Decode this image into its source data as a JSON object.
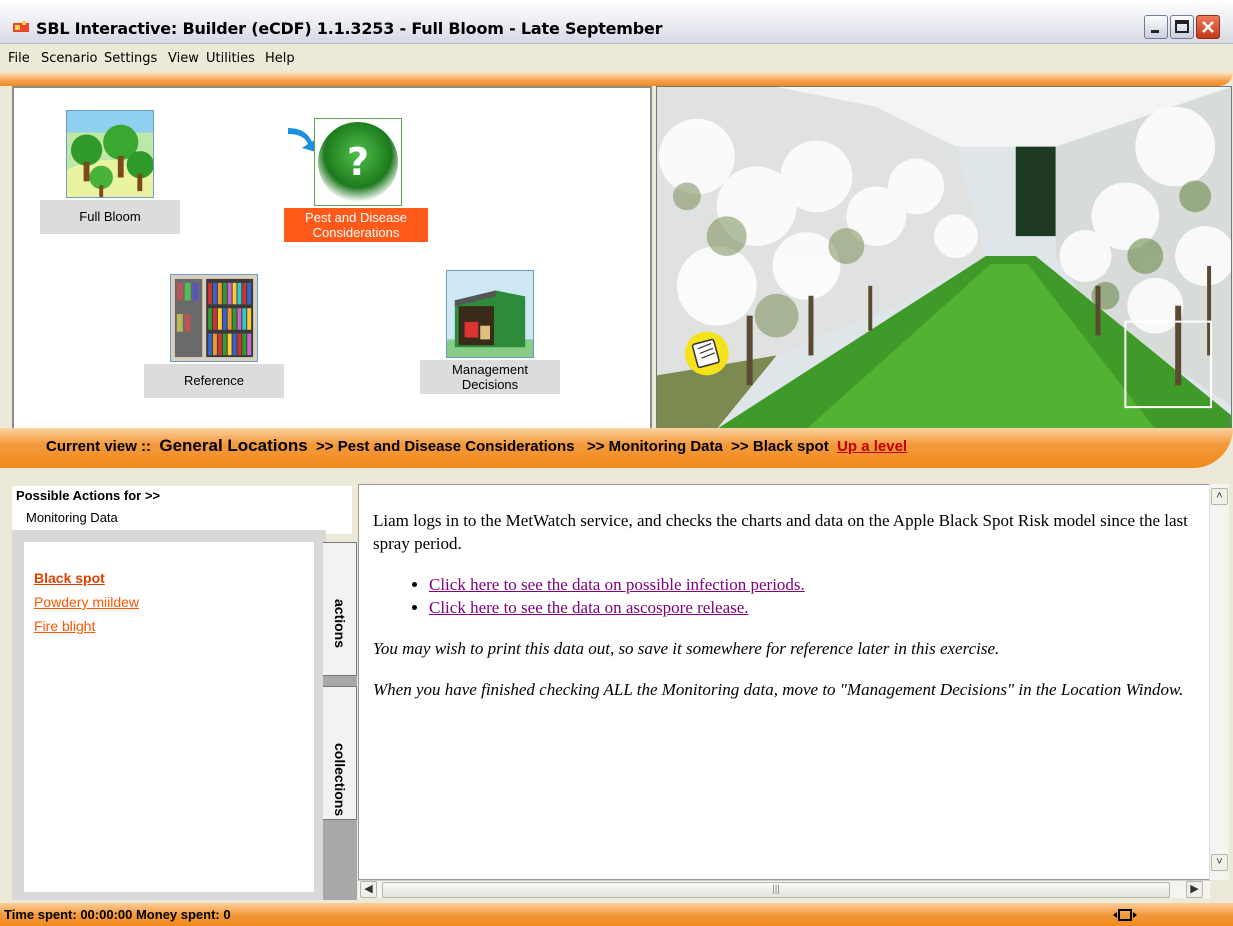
{
  "window": {
    "title": "SBL Interactive: Builder (eCDF) 1.1.3253 - Full Bloom - Late September"
  },
  "menu": [
    "File",
    "Scenario",
    "Settings",
    "View",
    "Utilities",
    "Help"
  ],
  "locations": {
    "full_bloom": "Full Bloom",
    "pest": [
      "Pest and Disease",
      "Considerations"
    ],
    "reference": "Reference",
    "management": [
      "Management",
      "Decisions"
    ]
  },
  "breadcrumb": {
    "prefix": "Current view ::",
    "root": "General Locations",
    "part1": ">> Pest and Disease Considerations",
    "part2": ">> Monitoring Data",
    "part3": ">> Black spot",
    "up": "Up a level"
  },
  "actions": {
    "title": "Possible Actions for >>",
    "subtitle": "Monitoring Data",
    "items": [
      "Black spot",
      "Powdery miildew",
      "Fire blight"
    ]
  },
  "tabs": {
    "actions": "actions",
    "collections": "collections"
  },
  "content": {
    "intro": "Liam logs in to the MetWatch service, and checks the charts and data on the Apple Black Spot Risk model since the last spray period.",
    "links": [
      "Click here to see the data on possible infection periods.",
      "Click here to see the data on ascospore release."
    ],
    "note1": "You may wish to print this data out, so save it somewhere for reference later in this exercise.",
    "note2": "When you have finished checking ALL the Monitoring data, move to \"Management Decisions\" in the Location Window."
  },
  "status": {
    "text": "Time spent: 00:00:00  Money spent: 0"
  },
  "colors": {
    "accent_orange": "#f08a1c",
    "link_orange": "#ff5500",
    "active_caption": "#ff5a1a"
  }
}
